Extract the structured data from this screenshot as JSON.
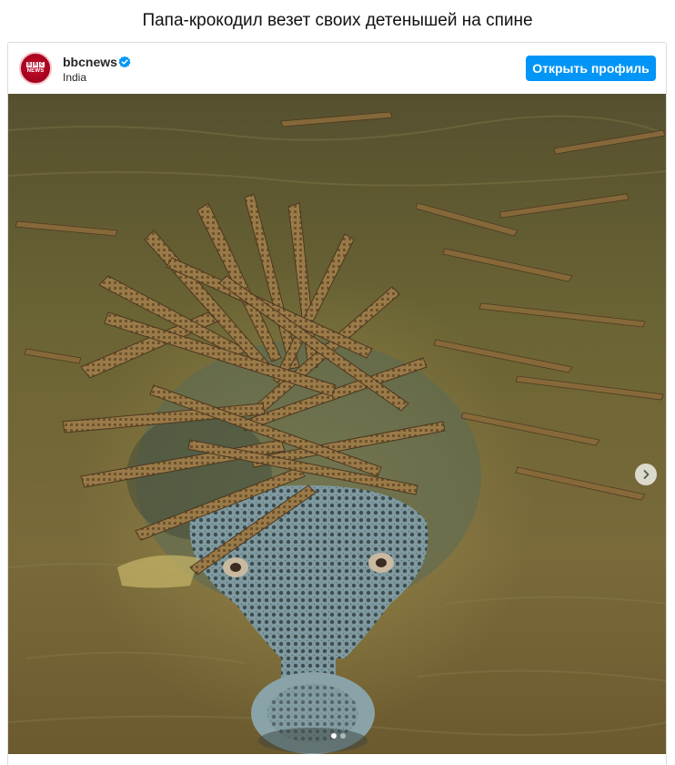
{
  "article": {
    "title": "Папа-крокодил везет своих детенышей на спине"
  },
  "post": {
    "account_name": "bbcnews",
    "location": "India",
    "verified": true,
    "open_profile_label": "Открыть профиль",
    "avatar_icon": "bbc-news-logo",
    "brand_color": "#bb1919",
    "button_color": "#0095f6",
    "media": {
      "type": "photo",
      "icon_next": "chevron-right-icon",
      "carousel_count": 2,
      "carousel_active": 1
    }
  },
  "avatar_logo": {
    "letters": [
      "B",
      "B",
      "C"
    ],
    "sub": "NEWS"
  }
}
